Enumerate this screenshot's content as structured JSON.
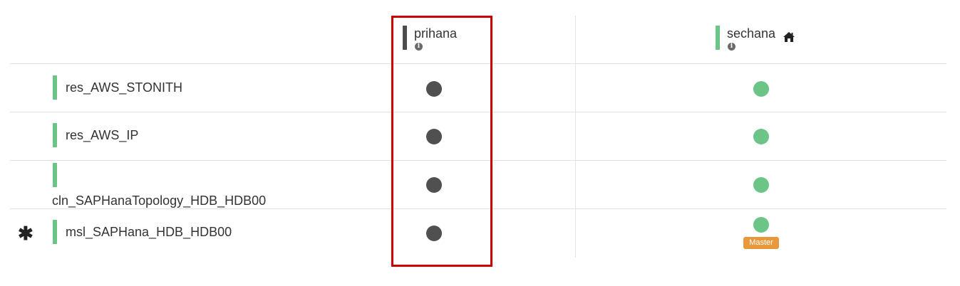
{
  "nodes": [
    {
      "name": "prihana",
      "info_icon": "info-icon",
      "is_current": false,
      "bar_color": "#4d4d4d"
    },
    {
      "name": "sechana",
      "info_icon": "info-icon",
      "is_current": true,
      "bar_color": "#6cc487",
      "extra_icon": "home-icon"
    }
  ],
  "resources": [
    {
      "name": "res_AWS_STONITH",
      "marker": "",
      "status": [
        "stopped",
        "started"
      ]
    },
    {
      "name": "res_AWS_IP",
      "marker": "",
      "status": [
        "stopped",
        "started"
      ]
    },
    {
      "name": "cln_SAPHanaTopology_HDB_HDB00",
      "marker": "",
      "status": [
        "stopped",
        "started"
      ]
    },
    {
      "name": "msl_SAPHana_HDB_HDB00",
      "marker": "✱",
      "status": [
        "stopped",
        "started"
      ],
      "badge": "Master"
    }
  ],
  "colors": {
    "started": "#6cc487",
    "stopped": "#505050",
    "master_badge": "#e8973a",
    "highlight": "#cc0000"
  }
}
